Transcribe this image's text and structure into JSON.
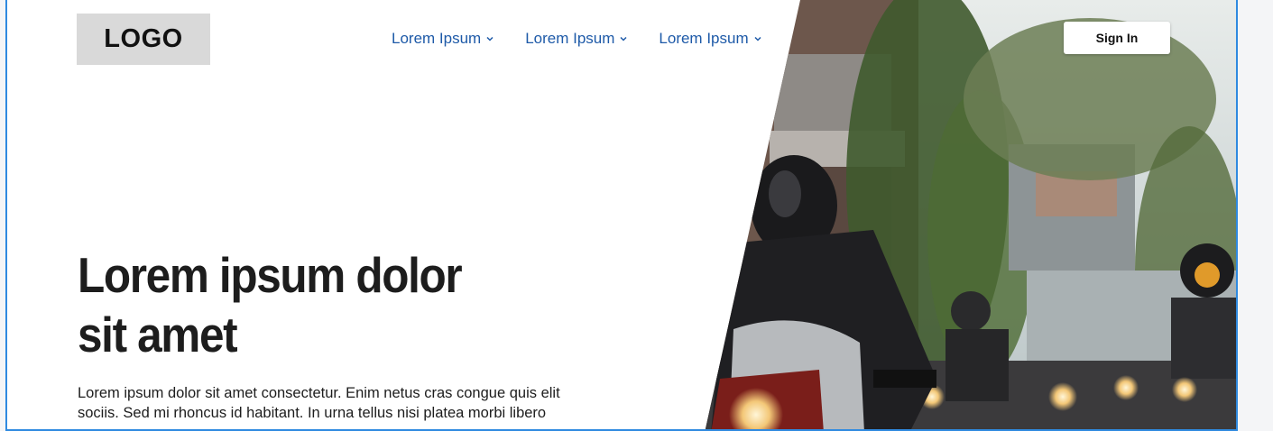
{
  "logo": {
    "text": "LOGO"
  },
  "nav": {
    "items": [
      {
        "label": "Lorem Ipsum"
      },
      {
        "label": "Lorem Ipsum"
      },
      {
        "label": "Lorem Ipsum"
      }
    ]
  },
  "header": {
    "sign_in_label": "Sign In"
  },
  "hero": {
    "headline_line1": "Lorem ipsum dolor",
    "headline_line2": "sit amet",
    "body_line1": "Lorem ipsum dolor sit amet consectetur. Enim netus cras congue quis elit",
    "body_line2": "sociis. Sed mi rhoncus id habitant. In urna tellus nisi platea morbi libero"
  },
  "colors": {
    "accent_border": "#2f8ae0",
    "nav_link": "#1e5aa8",
    "logo_bg": "#d9d9d9"
  },
  "icons": {
    "nav_chevron": "chevron-down-icon"
  }
}
